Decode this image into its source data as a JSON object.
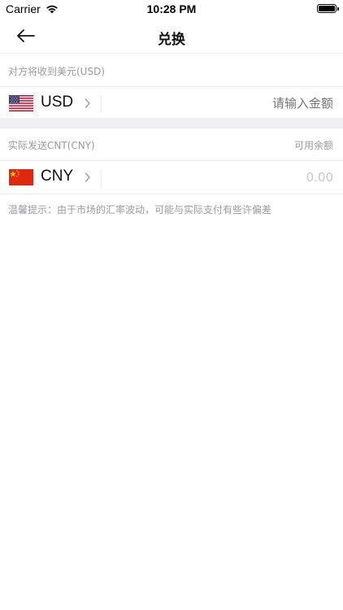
{
  "status_bar": {
    "carrier": "Carrier",
    "time": "10:28 PM"
  },
  "nav": {
    "title": "兑换"
  },
  "receive_section": {
    "label": "对方将收到美元(USD)",
    "currency_code": "USD",
    "amount_placeholder": "请输入金额",
    "flag": "us-flag-icon"
  },
  "send_section": {
    "label": "实际发送CNT(CNY)",
    "right_label": "可用余额",
    "currency_code": "CNY",
    "amount_value": "0.00",
    "flag": "cn-flag-icon"
  },
  "notice": "温馨提示：由于市场的汇率波动，可能与实际支付有些许偏差",
  "colors": {
    "muted_text": "#9a9a9f",
    "band": "#efeff4",
    "placeholder": "#c7c7cc"
  }
}
